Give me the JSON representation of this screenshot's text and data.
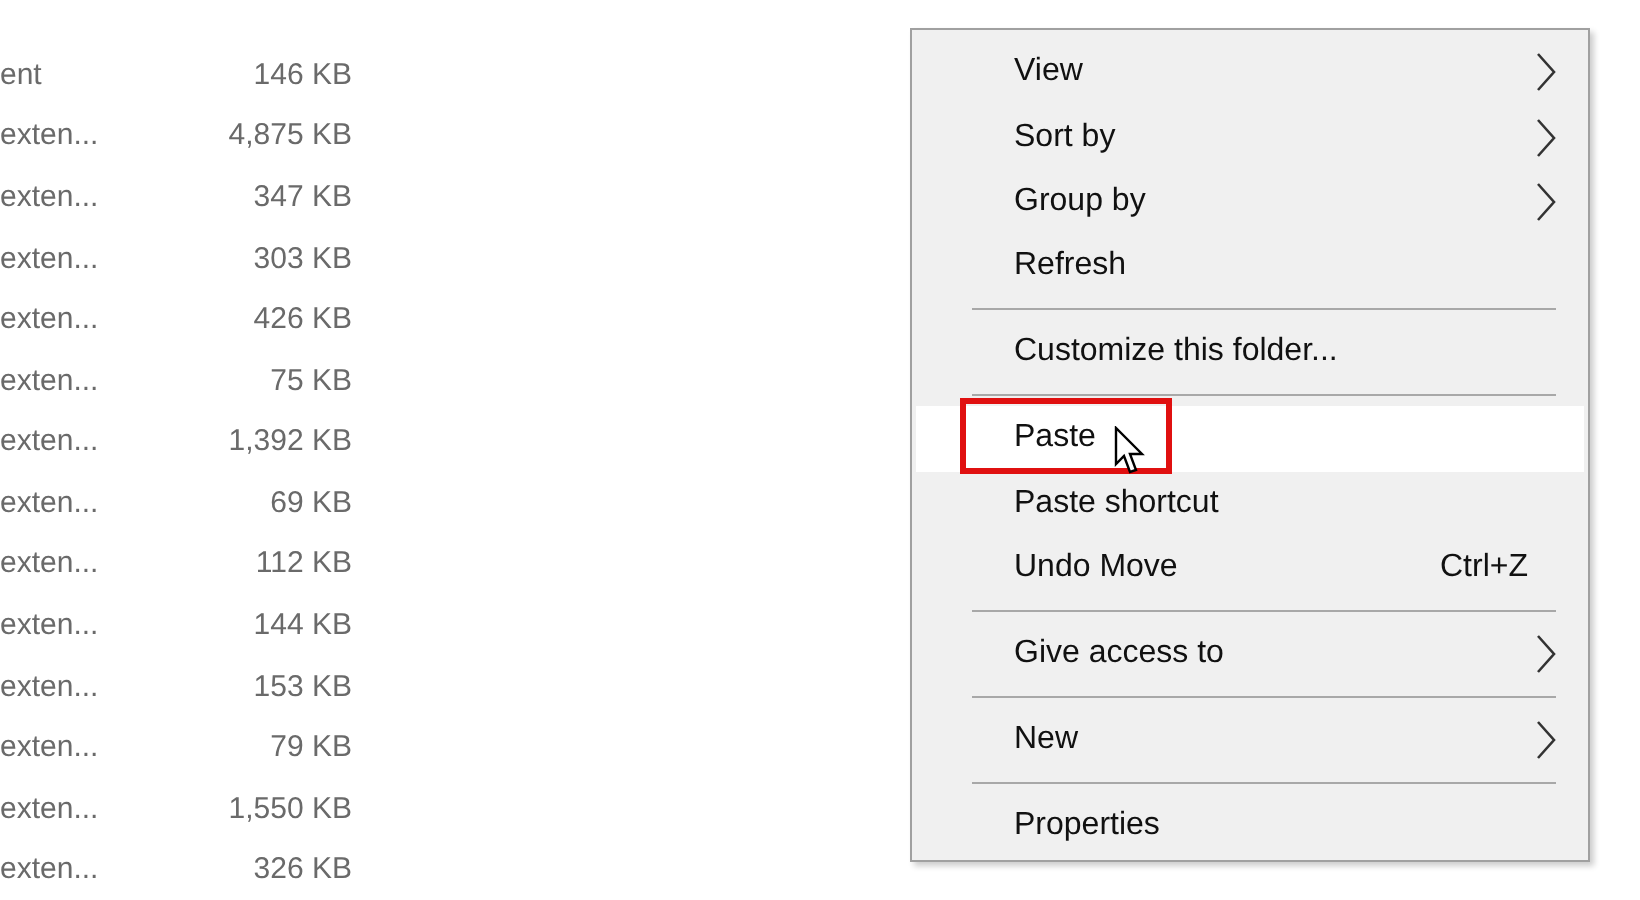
{
  "files": [
    {
      "type": "ent",
      "size": "146 KB"
    },
    {
      "type": "exten...",
      "size": "4,875 KB"
    },
    {
      "type": "exten...",
      "size": "347 KB"
    },
    {
      "type": "exten...",
      "size": "303 KB"
    },
    {
      "type": "exten...",
      "size": "426 KB"
    },
    {
      "type": "exten...",
      "size": "75 KB"
    },
    {
      "type": "exten...",
      "size": "1,392 KB"
    },
    {
      "type": "exten...",
      "size": "69 KB"
    },
    {
      "type": "exten...",
      "size": "112 KB"
    },
    {
      "type": "exten...",
      "size": "144 KB"
    },
    {
      "type": "exten...",
      "size": "153 KB"
    },
    {
      "type": "exten...",
      "size": "79 KB"
    },
    {
      "type": "exten...",
      "size": "1,550 KB"
    },
    {
      "type": "exten...",
      "size": "326 KB"
    }
  ],
  "context_menu": {
    "items": [
      {
        "kind": "item",
        "label": "View",
        "submenu": true,
        "selected": false
      },
      {
        "kind": "item",
        "label": "Sort by",
        "submenu": true,
        "selected": false
      },
      {
        "kind": "item",
        "label": "Group by",
        "submenu": true,
        "selected": false
      },
      {
        "kind": "item",
        "label": "Refresh",
        "submenu": false,
        "selected": false
      },
      {
        "kind": "separator"
      },
      {
        "kind": "item",
        "label": "Customize this folder...",
        "submenu": false,
        "selected": false
      },
      {
        "kind": "separator"
      },
      {
        "kind": "item",
        "label": "Paste",
        "submenu": false,
        "selected": true
      },
      {
        "kind": "item",
        "label": "Paste shortcut",
        "submenu": false,
        "selected": false
      },
      {
        "kind": "item",
        "label": "Undo Move",
        "shortcut": "Ctrl+Z",
        "submenu": false,
        "selected": false
      },
      {
        "kind": "separator"
      },
      {
        "kind": "item",
        "label": "Give access to",
        "submenu": true,
        "selected": false
      },
      {
        "kind": "separator"
      },
      {
        "kind": "item",
        "label": "New",
        "submenu": true,
        "selected": false
      },
      {
        "kind": "separator"
      },
      {
        "kind": "item",
        "label": "Properties",
        "submenu": false,
        "selected": false
      }
    ]
  }
}
